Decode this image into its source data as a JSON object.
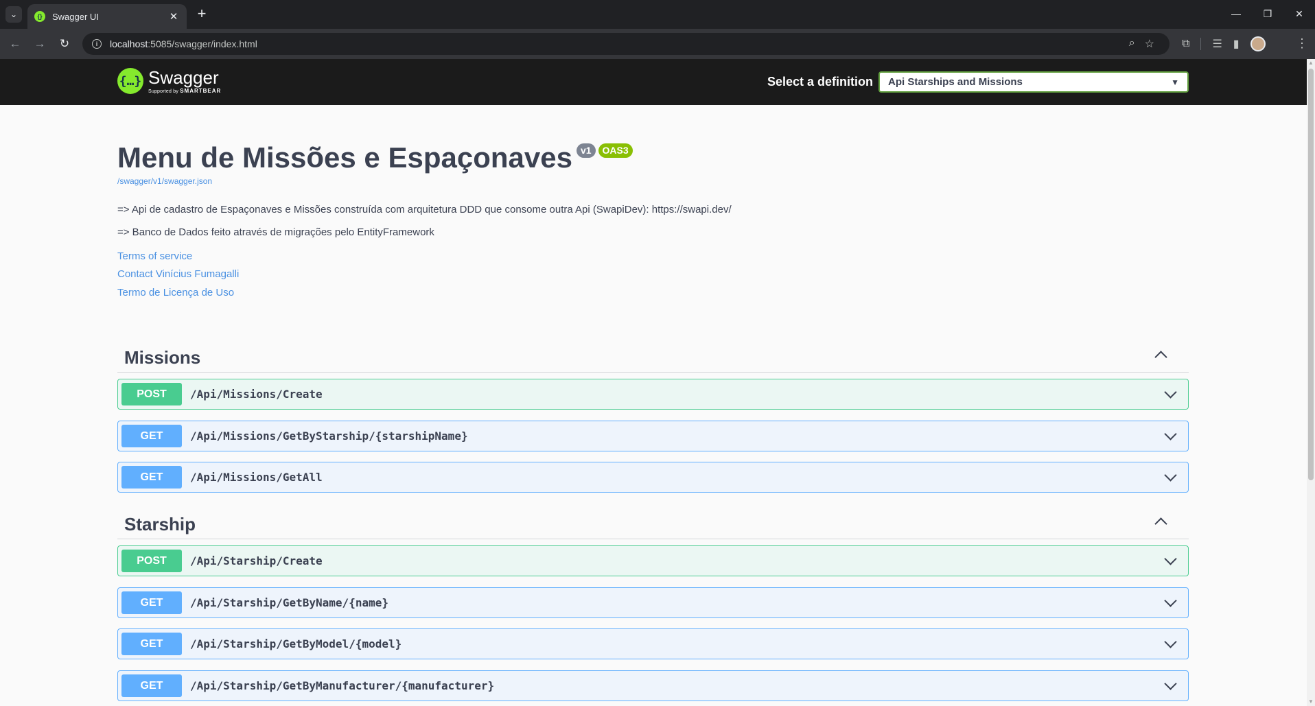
{
  "browser": {
    "tab_title": "Swagger UI",
    "url_host": "localhost",
    "url_rest": ":5085/swagger/index.html"
  },
  "topbar": {
    "logo_name": "Swagger",
    "logo_sub_prefix": "Supported by",
    "logo_sub_brand": "SMARTBEAR",
    "definition_label": "Select a definition",
    "definition_value": "Api Starships and Missions"
  },
  "info": {
    "title": "Menu de Missões e Espaçonaves",
    "version": "v1",
    "oas": "OAS3",
    "spec_url": "/swagger/v1/swagger.json",
    "description_1": "=> Api de cadastro de Espaçonaves e Missões construída com arquitetura DDD que consome outra Api (SwapiDev): https://swapi.dev/",
    "description_2": "=> Banco de Dados feito através de migrações pelo EntityFramework",
    "terms": "Terms of service",
    "contact": "Contact Vinícius Fumagalli",
    "license": "Termo de Licença de Uso"
  },
  "tags": [
    {
      "name": "Missions",
      "operations": [
        {
          "method": "POST",
          "path": "/Api/Missions/Create"
        },
        {
          "method": "GET",
          "path": "/Api/Missions/GetByStarship/{starshipName}"
        },
        {
          "method": "GET",
          "path": "/Api/Missions/GetAll"
        }
      ]
    },
    {
      "name": "Starship",
      "operations": [
        {
          "method": "POST",
          "path": "/Api/Starship/Create"
        },
        {
          "method": "GET",
          "path": "/Api/Starship/GetByName/{name}"
        },
        {
          "method": "GET",
          "path": "/Api/Starship/GetByModel/{model}"
        },
        {
          "method": "GET",
          "path": "/Api/Starship/GetByManufacturer/{manufacturer}"
        }
      ]
    }
  ],
  "colors": {
    "post": "#49cc90",
    "get": "#61affe",
    "brand": "#85ea2d",
    "text": "#3b4151",
    "link": "#4990e2"
  }
}
